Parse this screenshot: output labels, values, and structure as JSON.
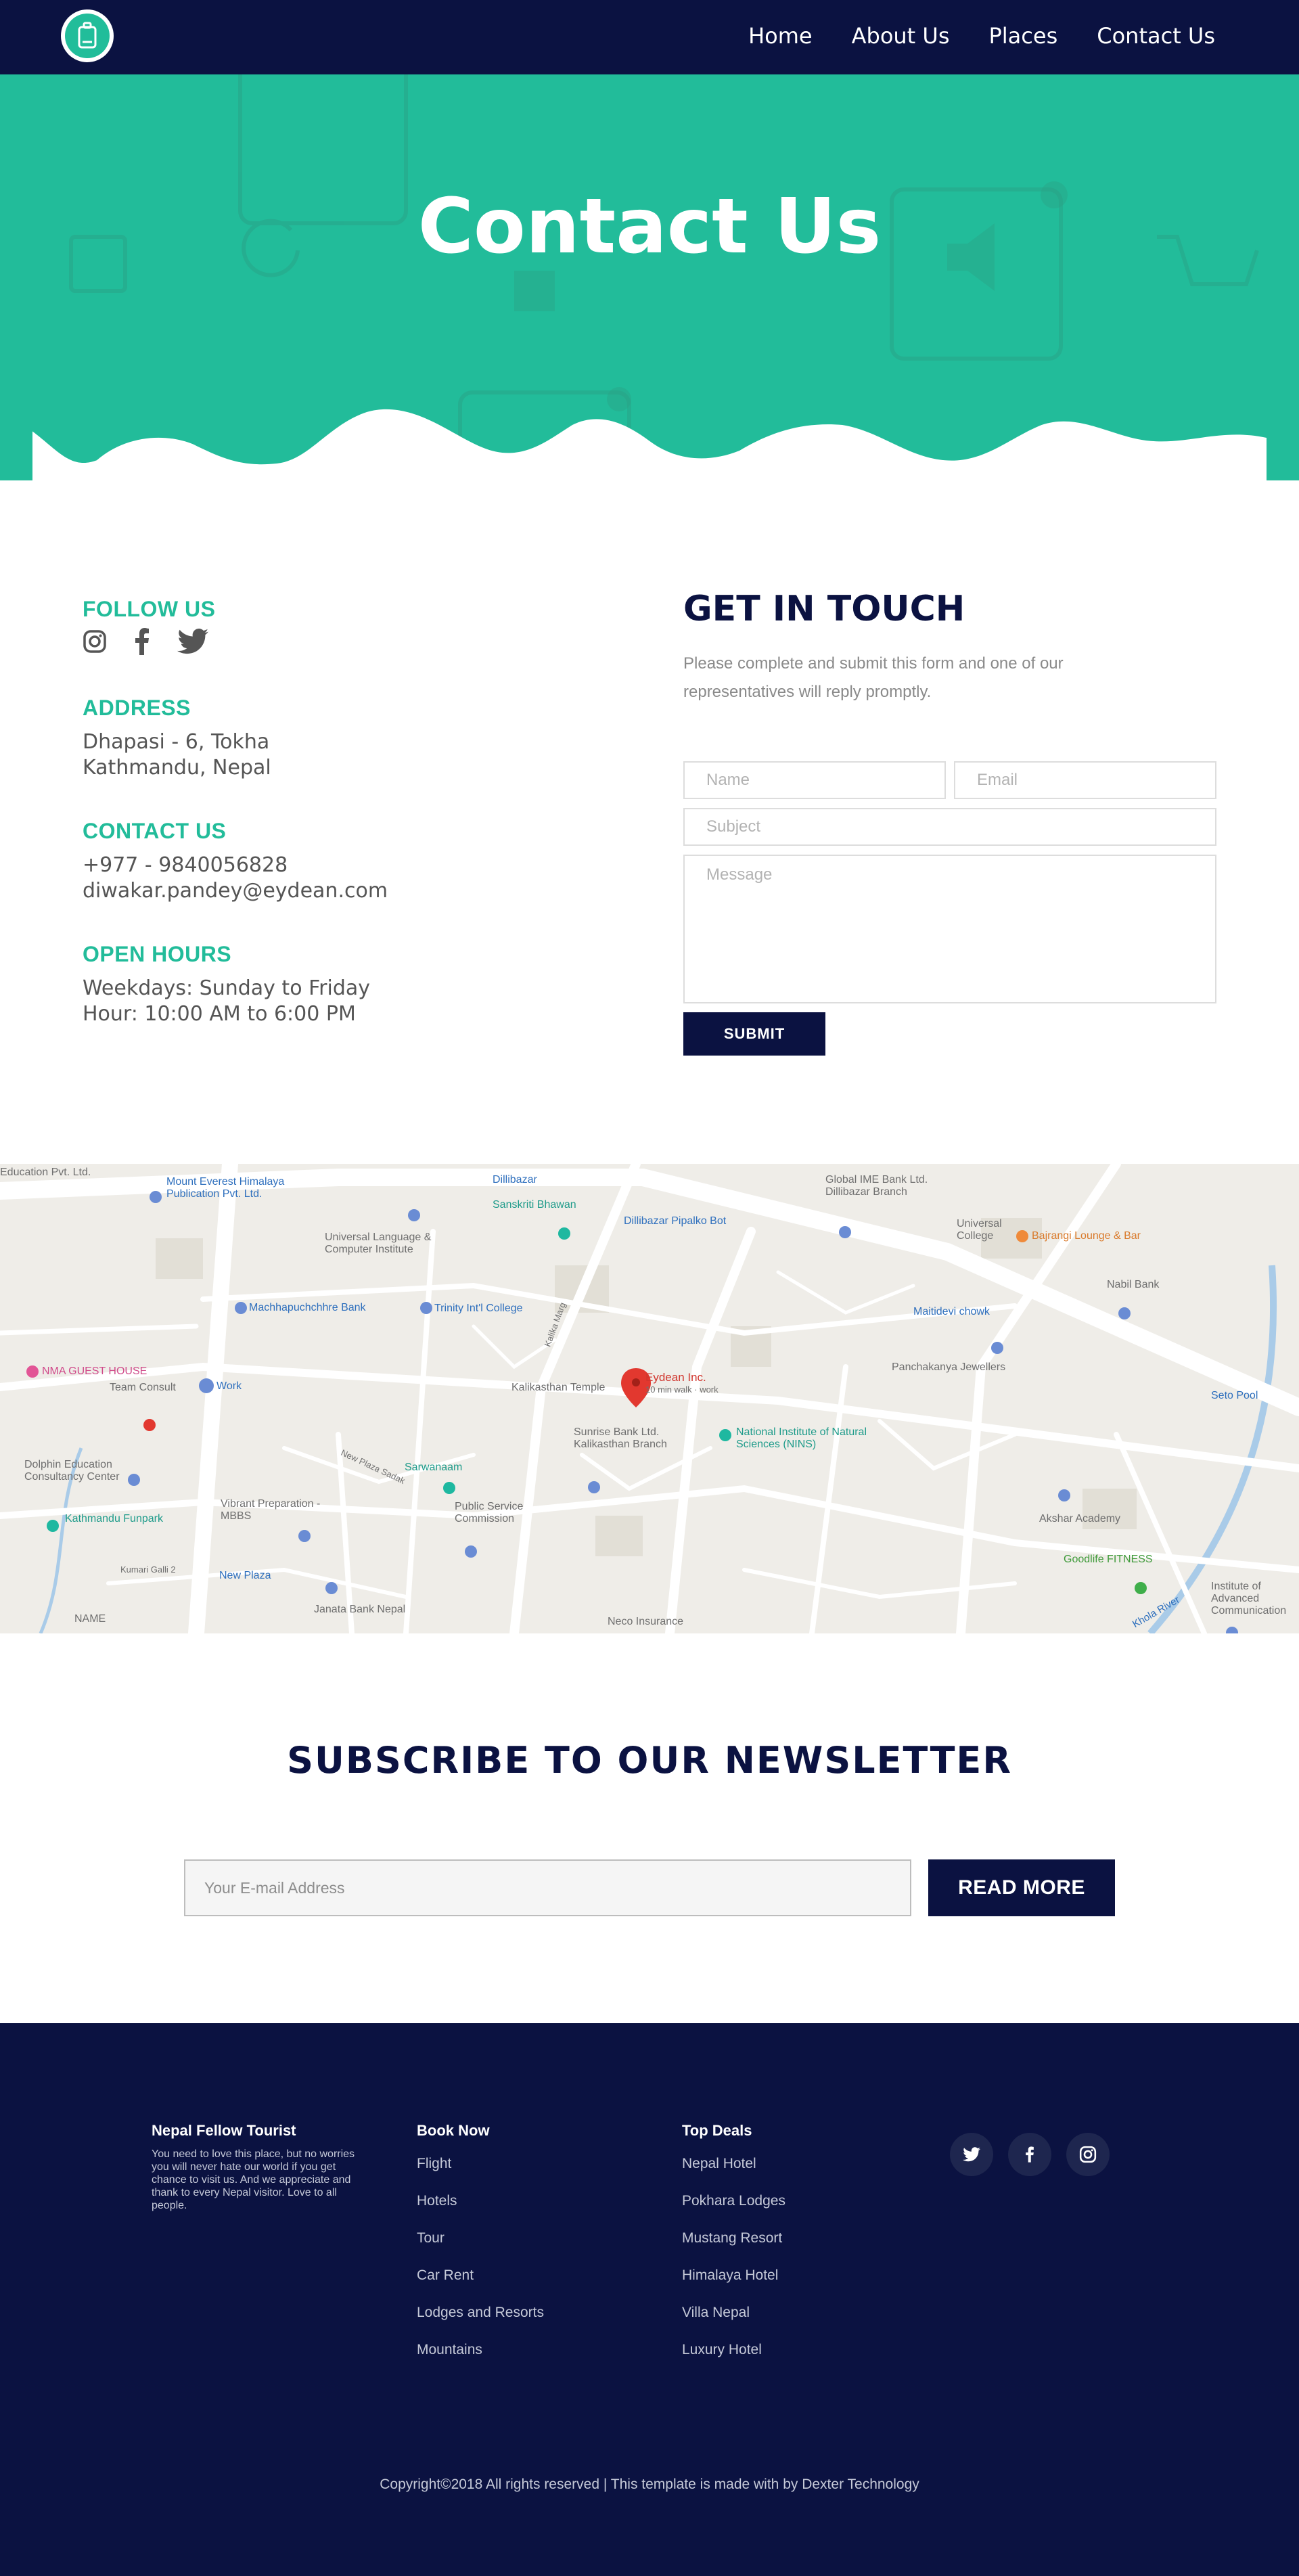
{
  "nav": {
    "logo_icon": "suitcase-icon",
    "links": [
      "Home",
      "About Us",
      "Places",
      "Contact Us"
    ]
  },
  "hero": {
    "title": "Contact Us"
  },
  "contact_info": {
    "follow_label": "FOLLOW US",
    "socials": [
      "instagram-icon",
      "facebook-icon",
      "twitter-icon"
    ],
    "address_label": "ADDRESS",
    "address_lines": [
      "Dhapasi - 6, Tokha",
      "Kathmandu, Nepal"
    ],
    "contact_label": "CONTACT US",
    "contact_lines": [
      "+977 - 9840056828",
      "diwakar.pandey@eydean.com"
    ],
    "hours_label": "OPEN HOURS",
    "hours_lines": [
      "Weekdays: Sunday to Friday",
      "Hour: 10:00 AM to 6:00 PM"
    ]
  },
  "form": {
    "title": "GET IN TOUCH",
    "description": "Please complete and submit this form and one of our representatives will reply promptly.",
    "name_placeholder": "Name",
    "email_placeholder": "Email",
    "subject_placeholder": "Subject",
    "message_placeholder": "Message",
    "submit_label": "SUBMIT"
  },
  "map": {
    "marker_label": "Eydean Inc.",
    "marker_sub": "10 min walk · work",
    "places": [
      "Mount Everest Himalaya Publication Pvt. Ltd.",
      "Dillibazar",
      "Sanskriti Bhawan",
      "Dillibazar Pipalko Bot",
      "Global IME Bank Ltd. Dillibazar Branch",
      "Universal College",
      "Bajrangi Lounge & Bar",
      "Universal Language & Computer Institute",
      "Machhapuchchhre Bank",
      "Trinity Int'l College",
      "Maitidevi chowk",
      "Nabil Bank",
      "NMA GUEST HOUSE",
      "Team Consult",
      "Work",
      "Kalikasthan Temple",
      "Panchakanya Jewellers",
      "Seto Pool",
      "Sunrise Bank Ltd. Kalikasthan Branch",
      "National Institute of Natural Sciences (NINS)",
      "Dolphin Education Consultancy Center",
      "Sarwanaam",
      "Vibrant Preparation - MBBS",
      "Public Service Commission",
      "Akshar Academy",
      "Kathmandu Funpark",
      "Goodlife FITNESS",
      "New Plaza",
      "Janata Bank Nepal",
      "Neco Insurance",
      "Institute of Advanced Communication",
      "Kumari Galli 2",
      "NAME",
      "Kalika Marg",
      "New Plaza Sadak",
      "Khola River",
      "Education Pvt. Ltd."
    ]
  },
  "newsletter": {
    "title": "SUBSCRIBE TO OUR NEWSLETTER",
    "placeholder": "Your E-mail Address",
    "button_label": "READ MORE"
  },
  "footer": {
    "brand_title": "Nepal Fellow Tourist",
    "brand_text": "You need to love this place, but no worries you will never hate our world if you get chance to visit us. And we appreciate and thank to every Nepal visitor. Love to all people.",
    "book_title": "Book Now",
    "book_items": [
      "Flight",
      "Hotels",
      "Tour",
      "Car Rent",
      "Lodges and Resorts",
      "Mountains"
    ],
    "deals_title": "Top Deals",
    "deals_items": [
      "Nepal Hotel",
      "Pokhara Lodges",
      "Mustang Resort",
      "Himalaya Hotel",
      "Villa Nepal",
      "Luxury Hotel"
    ],
    "socials": [
      "twitter-icon",
      "facebook-icon",
      "instagram-icon"
    ],
    "copyright": "Copyright©2018 All rights reserved | This template is made with by Dexter Technology"
  },
  "colors": {
    "navy": "#0b1241",
    "teal": "#22bc9a"
  }
}
